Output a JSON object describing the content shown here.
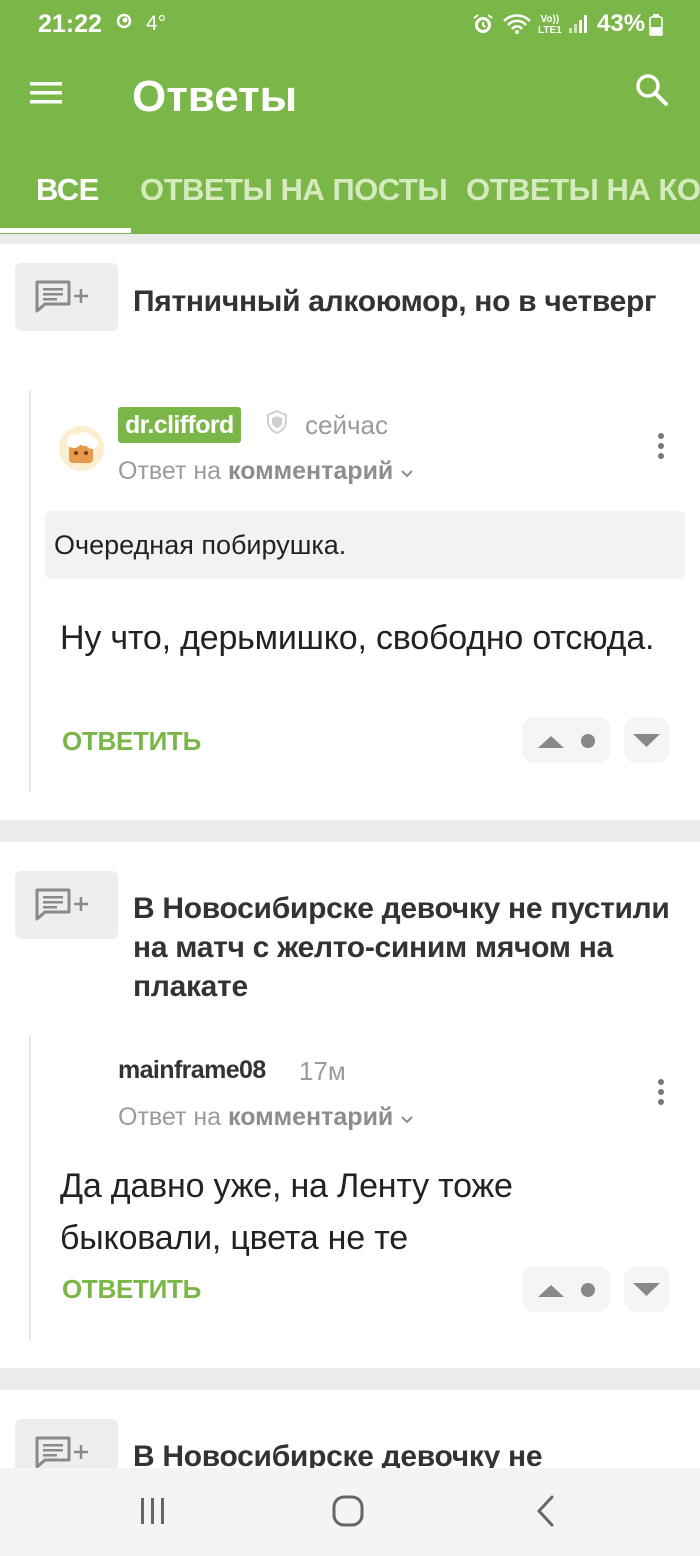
{
  "status_bar": {
    "time": "21:22",
    "temperature": "4°",
    "network_label_top": "Vo))",
    "network_label_bottom": "LTE1",
    "battery": "43%"
  },
  "app_bar": {
    "title": "Ответы"
  },
  "tabs": [
    {
      "label": "ВСЕ",
      "active": true
    },
    {
      "label": "ОТВЕТЫ НА ПОСТЫ",
      "active": false
    },
    {
      "label": "ОТВЕТЫ НА КО",
      "active": false
    }
  ],
  "cards": [
    {
      "post_title": "Пятничный алкоюмор, но в четверг",
      "author": "dr.clifford",
      "time": "сейчас",
      "reply_prefix": "Ответ на",
      "reply_target": "комментарий",
      "quote": "Очередная побирушка.",
      "text": "Ну что, дерьмишко, свободно отсюда.",
      "reply_label": "ОТВЕТИТЬ"
    },
    {
      "post_title": "В Новосибирске девочку не пустили на матч с желто-синим мячом на плакате",
      "author": "mainframe08",
      "time": "17м",
      "reply_prefix": "Ответ на",
      "reply_target": "комментарий",
      "text": "Да давно уже, на Ленту тоже быковали, цвета не те",
      "reply_label": "ОТВЕТИТЬ"
    },
    {
      "post_title": "В Новосибирске девочку не"
    }
  ],
  "colors": {
    "brand_green": "#7ab648",
    "inactive_tab": "#d5ebbd",
    "muted_text": "#9b9b9b"
  },
  "icons": [
    "menu-icon",
    "search-icon",
    "add-comment-icon",
    "shield-icon",
    "more-vert-icon",
    "arrow-up-icon",
    "arrow-down-icon",
    "recent-apps-icon",
    "home-icon",
    "back-icon"
  ]
}
